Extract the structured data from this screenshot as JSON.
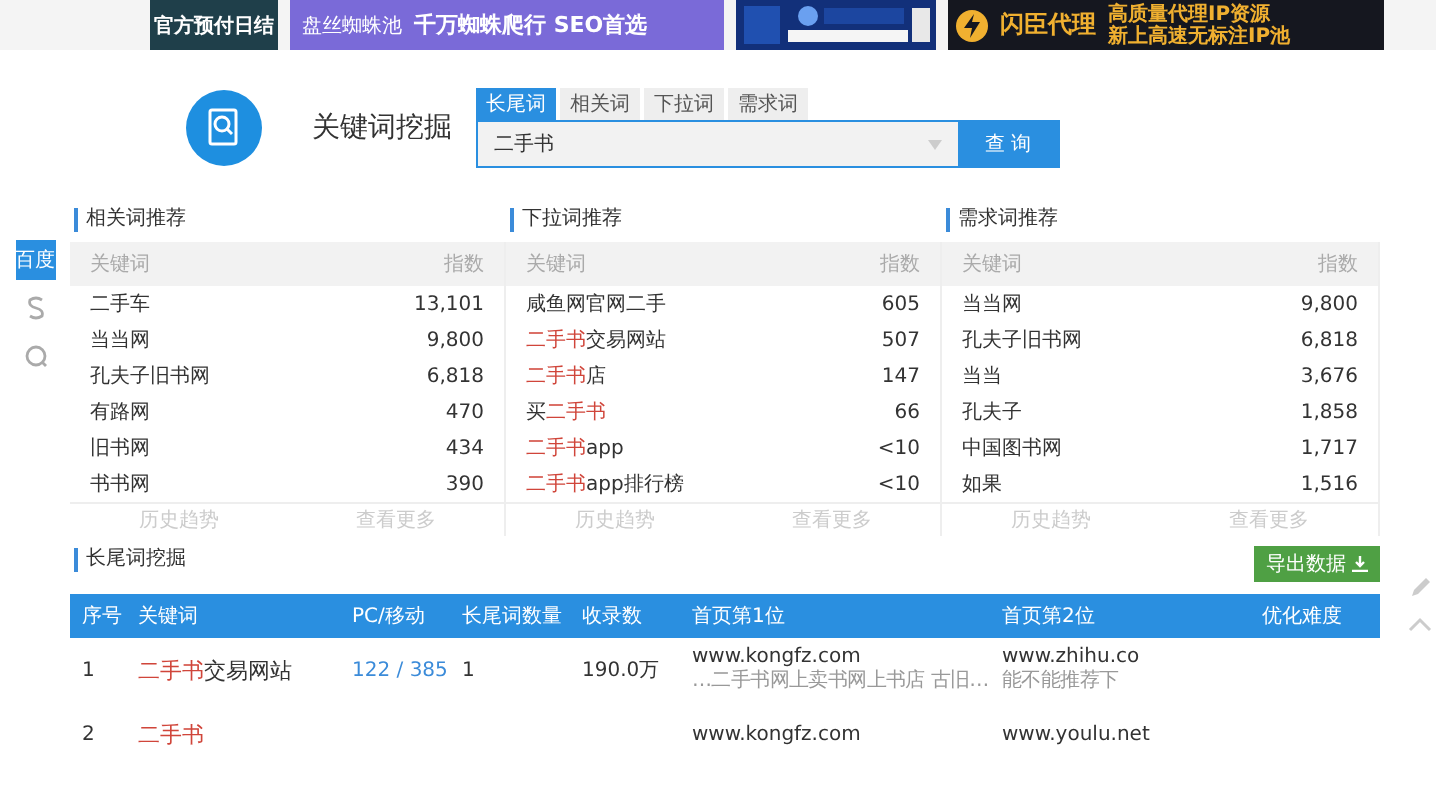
{
  "banners": [
    {
      "kind": "text",
      "lines": [
        "官方预付日结"
      ]
    },
    {
      "kind": "spider",
      "brand": "盘丝蜘蛛池",
      "slogan": "千万蜘蛛爬行 SEO首选"
    },
    {
      "kind": "picture"
    },
    {
      "kind": "proxy",
      "brand": "闪臣代理",
      "lines": [
        "高质量代理IP资源",
        "新上高速无标注IP池"
      ]
    }
  ],
  "search": {
    "title": "关键词挖掘",
    "tabs": [
      {
        "label": "长尾词",
        "selected": true
      },
      {
        "label": "相关词",
        "selected": false
      },
      {
        "label": "下拉词",
        "selected": false
      },
      {
        "label": "需求词",
        "selected": false
      }
    ],
    "value": "二手书",
    "button": "查 询"
  },
  "engines": [
    {
      "kind": "text",
      "label": "百度",
      "selected": true
    },
    {
      "kind": "sogou",
      "selected": false
    },
    {
      "kind": "so360",
      "selected": false
    }
  ],
  "panels": [
    {
      "title": "相关词推荐",
      "columns": [
        "关键词",
        "指数"
      ],
      "rows": [
        {
          "keyword": [
            {
              "text": "二手车",
              "hit": false
            }
          ],
          "index": "13,101"
        },
        {
          "keyword": [
            {
              "text": "当当网",
              "hit": false
            }
          ],
          "index": "9,800"
        },
        {
          "keyword": [
            {
              "text": "孔夫子旧书网",
              "hit": false
            }
          ],
          "index": "6,818"
        },
        {
          "keyword": [
            {
              "text": "有路网",
              "hit": false
            }
          ],
          "index": "470"
        },
        {
          "keyword": [
            {
              "text": "旧书网",
              "hit": false
            }
          ],
          "index": "434"
        },
        {
          "keyword": [
            {
              "text": "书书网",
              "hit": false
            }
          ],
          "index": "390"
        }
      ],
      "links": [
        "历史趋势",
        "查看更多"
      ]
    },
    {
      "title": "下拉词推荐",
      "columns": [
        "关键词",
        "指数"
      ],
      "rows": [
        {
          "keyword": [
            {
              "text": "咸鱼网官网二手",
              "hit": false
            }
          ],
          "index": "605"
        },
        {
          "keyword": [
            {
              "text": "二手书",
              "hit": true
            },
            {
              "text": "交易网站",
              "hit": false
            }
          ],
          "index": "507"
        },
        {
          "keyword": [
            {
              "text": "二手书",
              "hit": true
            },
            {
              "text": "店",
              "hit": false
            }
          ],
          "index": "147"
        },
        {
          "keyword": [
            {
              "text": "买",
              "hit": false
            },
            {
              "text": "二手书",
              "hit": true
            }
          ],
          "index": "66"
        },
        {
          "keyword": [
            {
              "text": "二手书",
              "hit": true
            },
            {
              "text": "app",
              "hit": false
            }
          ],
          "index": "<10"
        },
        {
          "keyword": [
            {
              "text": "二手书",
              "hit": true
            },
            {
              "text": "app排行榜",
              "hit": false
            }
          ],
          "index": "<10"
        }
      ],
      "links": [
        "历史趋势",
        "查看更多"
      ]
    },
    {
      "title": "需求词推荐",
      "columns": [
        "关键词",
        "指数"
      ],
      "rows": [
        {
          "keyword": [
            {
              "text": "当当网",
              "hit": false
            }
          ],
          "index": "9,800"
        },
        {
          "keyword": [
            {
              "text": "孔夫子旧书网",
              "hit": false
            }
          ],
          "index": "6,818"
        },
        {
          "keyword": [
            {
              "text": "当当",
              "hit": false
            }
          ],
          "index": "3,676"
        },
        {
          "keyword": [
            {
              "text": "孔夫子",
              "hit": false
            }
          ],
          "index": "1,858"
        },
        {
          "keyword": [
            {
              "text": "中国图书网",
              "hit": false
            }
          ],
          "index": "1,717"
        },
        {
          "keyword": [
            {
              "text": "如果",
              "hit": false
            }
          ],
          "index": "1,516"
        }
      ],
      "links": [
        "历史趋势",
        "查看更多"
      ]
    }
  ],
  "long_tail": {
    "title": "长尾词挖掘",
    "export": "导出数据",
    "columns": [
      "序号",
      "关键词",
      "PC/移动",
      "长尾词数量",
      "收录数",
      "首页第1位",
      "首页第2位",
      "优化难度"
    ],
    "rows": [
      {
        "no": "1",
        "keyword": [
          {
            "text": "二手书",
            "hit": true
          },
          {
            "text": "交易网站",
            "hit": false
          }
        ],
        "pc_mobile": "122 / 385",
        "count": "1",
        "indexed": "190.0万",
        "first": {
          "url": "www.kongfz.com",
          "desc": "…二手书网上卖书网上书店 古旧…"
        },
        "second": {
          "url": "www.zhihu.co",
          "desc": "能不能推荐下"
        }
      },
      {
        "no": "2",
        "keyword": [
          {
            "text": "二手书",
            "hit": true
          }
        ],
        "first": {
          "url": "www.kongfz.com"
        },
        "second": {
          "url": "www.youlu.net"
        }
      }
    ]
  }
}
